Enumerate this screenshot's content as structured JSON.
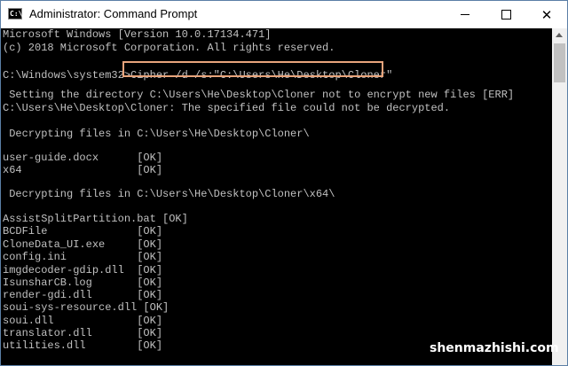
{
  "window": {
    "title": "Administrator: Command Prompt",
    "app_icon_glyph": "C:\\",
    "app_icon": "cmd-icon",
    "controls": {
      "minimize": "minimize-icon",
      "maximize": "maximize-icon",
      "close_glyph": "✕"
    }
  },
  "console": {
    "lines": [
      "Microsoft Windows [Version 10.0.17134.471]",
      "(c) 2018 Microsoft Corporation. All rights reserved.",
      "",
      "C:\\Windows\\system32>Cipher /d /s:\"C:\\Users\\He\\Desktop\\Cloner\"",
      "",
      " Setting the directory C:\\Users\\He\\Desktop\\Cloner not to encrypt new files [ERR]",
      "C:\\Users\\He\\Desktop\\Cloner: The specified file could not be decrypted.",
      "",
      " Decrypting files in C:\\Users\\He\\Desktop\\Cloner\\",
      "",
      "user-guide.docx      [OK]",
      "x64                  [OK]",
      "",
      " Decrypting files in C:\\Users\\He\\Desktop\\Cloner\\x64\\",
      "",
      "AssistSplitPartition.bat [OK]",
      "BCDFile              [OK]",
      "CloneData_UI.exe     [OK]",
      "config.ini           [OK]",
      "imgdecoder-gdip.dll  [OK]",
      "IsunsharCB.log       [OK]",
      "render-gdi.dll       [OK]",
      "soui-sys-resource.dll [OK]",
      "soui.dll             [OK]",
      "translator.dll       [OK]",
      "utilities.dll        [OK]"
    ]
  },
  "watermark": "shenmazhishi.com",
  "colors": {
    "console_bg": "#000000",
    "console_text": "#c0c0c0",
    "highlight_border": "#e8a47c"
  }
}
